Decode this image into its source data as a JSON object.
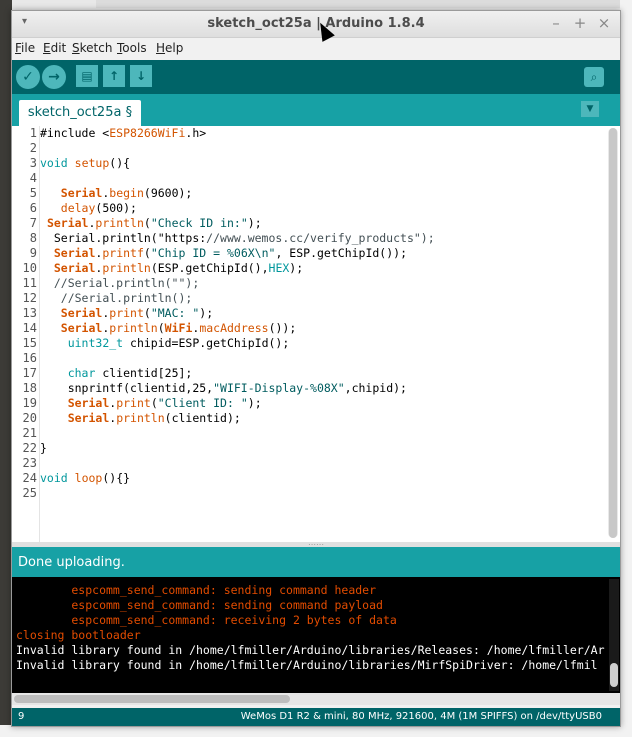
{
  "window": {
    "title": "sketch_oct25a | Arduino 1.8.4",
    "menu_glyph": "▾",
    "minimize": "–",
    "maximize": "+",
    "close": "×"
  },
  "menu": {
    "items": [
      {
        "underlined": "F",
        "rest": "ile"
      },
      {
        "underlined": "E",
        "rest": "dit"
      },
      {
        "underlined": "S",
        "rest": "ketch"
      },
      {
        "underlined": "T",
        "rest": "ools"
      },
      {
        "underlined": "H",
        "rest": "elp"
      }
    ]
  },
  "toolbar": {
    "verify_icon": "✓",
    "upload_icon": "→",
    "new_icon": "▤",
    "open_icon": "↑",
    "save_icon": "↓",
    "serial_monitor_icon": "⌕"
  },
  "tabs": {
    "active_label": "sketch_oct25a §",
    "menu_glyph": "▼"
  },
  "editor": {
    "line_numbers": [
      "1",
      "2",
      "3",
      "4",
      "5",
      "6",
      "7",
      "8",
      "9",
      "10",
      "11",
      "12",
      "13",
      "14",
      "15",
      "16",
      "17",
      "18",
      "19",
      "20",
      "21",
      "22",
      "23",
      "24",
      "25"
    ],
    "lines": [
      "#include <ESP8266WiFi.h>",
      "",
      "void setup(){",
      "",
      "   Serial.begin(9600);",
      "   delay(500);",
      " Serial.println(\"Check ID in:\");",
      "  Serial.println(\"https://www.wemos.cc/verify_products\");",
      "  Serial.printf(\"Chip ID = %06X\\n\", ESP.getChipId());",
      "  Serial.println(ESP.getChipId(),HEX);",
      "  //Serial.println(\"\");",
      "   //Serial.println();",
      "   Serial.print(\"MAC: \");",
      "   Serial.println(WiFi.macAddress());",
      "    uint32_t chipid=ESP.getChipId();",
      "",
      "    char clientid[25];",
      "    snprintf(clientid,25,\"WIFI-Display-%08X\",chipid);",
      "    Serial.print(\"Client ID: \");",
      "    Serial.println(clientid);",
      "",
      "}",
      "",
      "void loop(){}",
      ""
    ]
  },
  "splitter_glyph": "⋯⋯",
  "status": {
    "message": "Done uploading."
  },
  "console": {
    "lines": [
      {
        "text": "        espcomm_send_command: sending command header",
        "color": "red"
      },
      {
        "text": "        espcomm_send_command: sending command payload",
        "color": "red"
      },
      {
        "text": "        espcomm_send_command: receiving 2 bytes of data",
        "color": "red"
      },
      {
        "text": "closing bootloader",
        "color": "red"
      },
      {
        "text": "Invalid library found in /home/lfmiller/Arduino/libraries/Releases: /home/lfmiller/Ar",
        "color": "white"
      },
      {
        "text": "Invalid library found in /home/lfmiller/Arduino/libraries/MirfSpiDriver: /home/lfmil",
        "color": "white"
      }
    ]
  },
  "footer": {
    "line_number": "9",
    "board_info": "WeMos D1 R2 & mini, 80 MHz, 921600, 4M (1M SPIFFS) on /dev/ttyUSB0"
  },
  "colors": {
    "toolbar": "#006468",
    "tabbar": "#17a1a5",
    "button": "#4db7bb",
    "keyword": "#e97366",
    "type": "#00979c",
    "library": "#d35400",
    "string": "#005c5f",
    "console_red": "#e34c00"
  }
}
